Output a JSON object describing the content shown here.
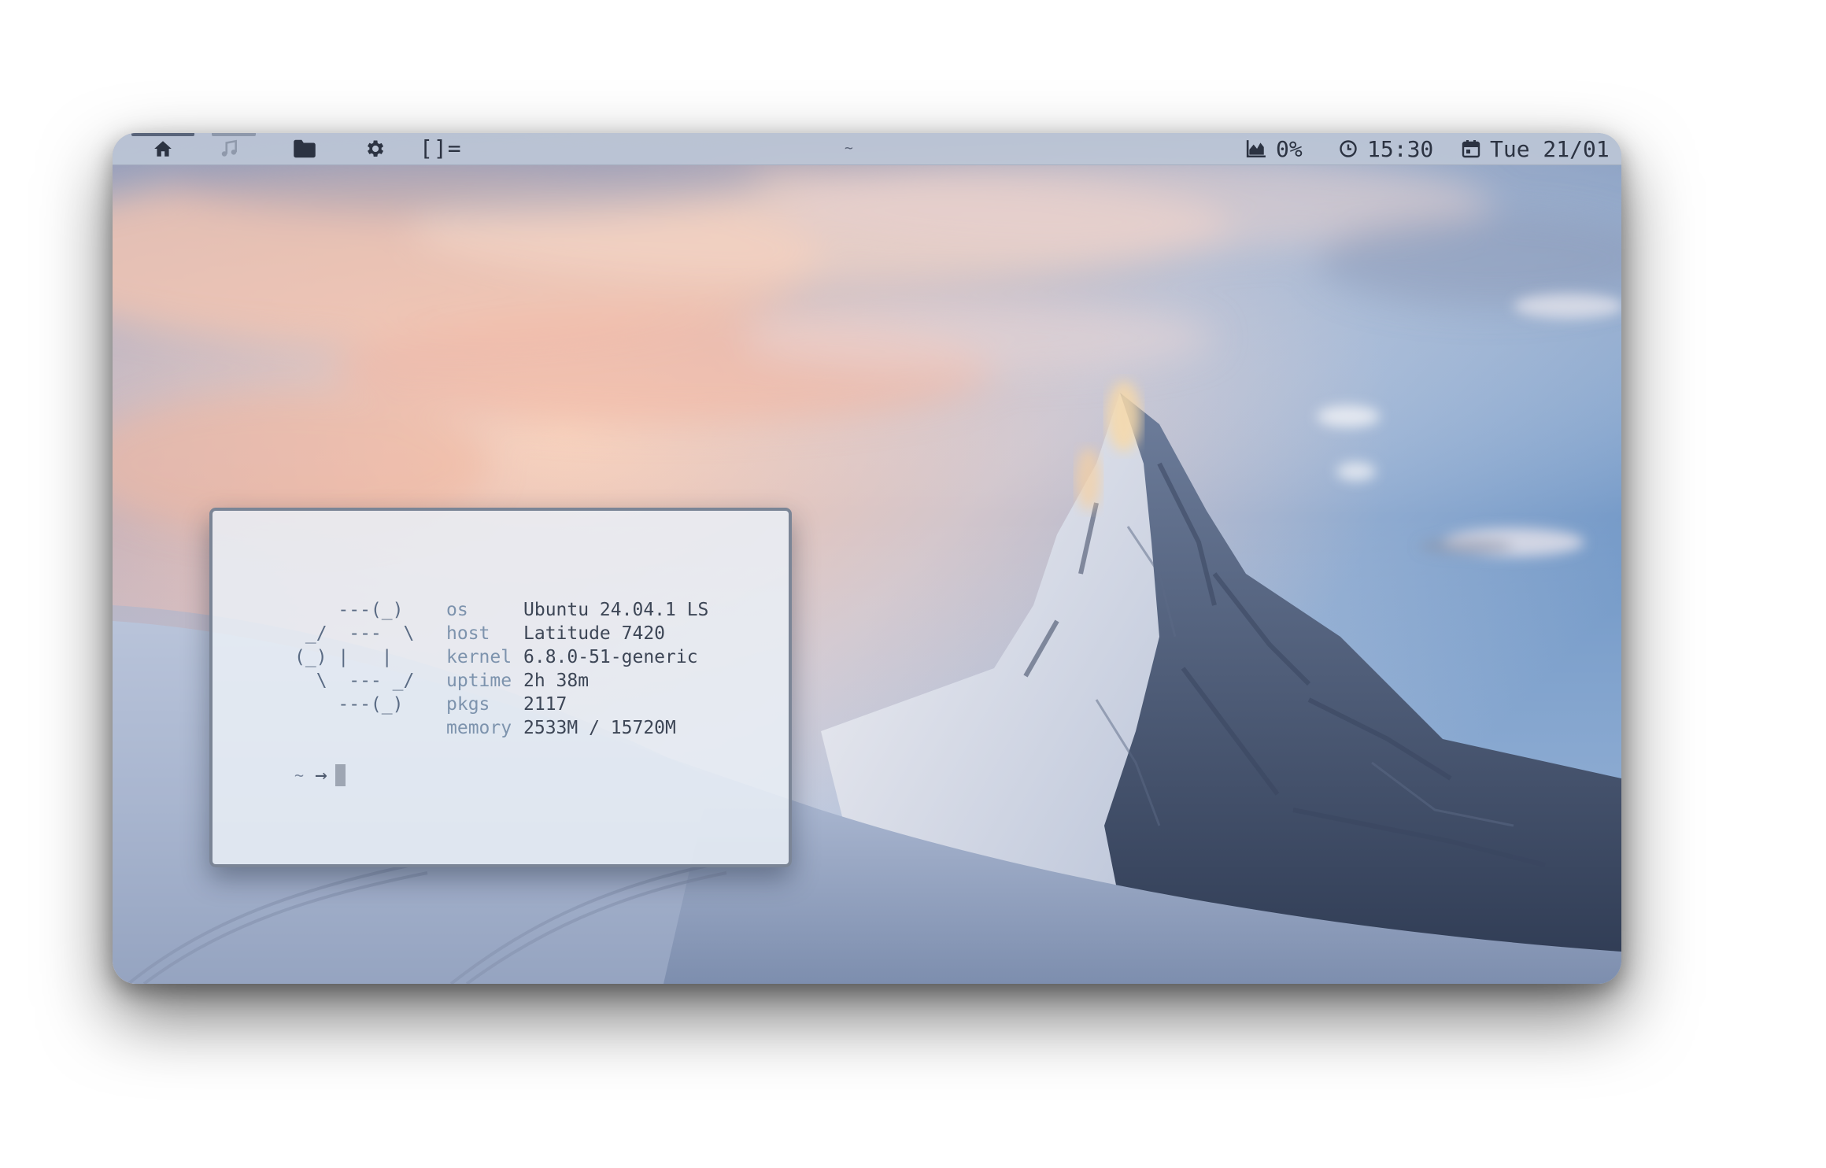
{
  "topbar": {
    "workspaces": [
      {
        "name": "home",
        "icon": "home-icon",
        "active": true
      },
      {
        "name": "music",
        "icon": "music-note-icon",
        "active": false
      },
      {
        "name": "files",
        "icon": "folder-icon",
        "active": false
      },
      {
        "name": "settings",
        "icon": "gear-icon",
        "active": false
      }
    ],
    "layout_symbol": "[]=",
    "window_title": "~",
    "cpu": {
      "icon": "area-chart-icon",
      "value": "0%"
    },
    "clock": {
      "icon": "clock-icon",
      "value": "15:30"
    },
    "date": {
      "icon": "calendar-icon",
      "value": "Tue 21/01"
    }
  },
  "terminal": {
    "ascii_logo": "    ---(_)\n _/  ---  \\\n(_) |   |\n  \\  --- _/\n    ---(_)",
    "fetch": [
      {
        "key": "os",
        "value": "Ubuntu 24.04.1 LS"
      },
      {
        "key": "host",
        "value": "Latitude 7420"
      },
      {
        "key": "kernel",
        "value": "6.8.0-51-generic"
      },
      {
        "key": "uptime",
        "value": "2h 38m"
      },
      {
        "key": "pkgs",
        "value": "2117"
      },
      {
        "key": "memory",
        "value": "2533M / 15720M"
      }
    ],
    "prompt_dir": "~",
    "prompt_symbol": "→"
  },
  "colors": {
    "bar_bg": "#bcc5d6",
    "bar_fg": "#2c3342",
    "terminal_bg": "#e9eff6",
    "terminal_border": "#7b8596",
    "fetch_key": "#7d93ad",
    "fetch_value": "#3d4656"
  }
}
